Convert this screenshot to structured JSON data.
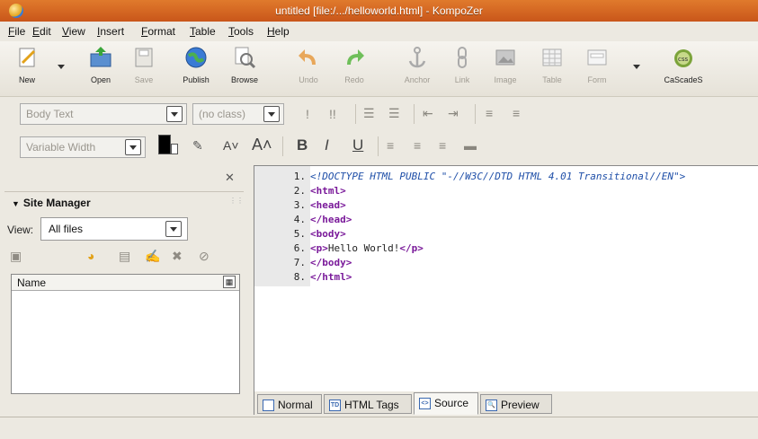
{
  "window": {
    "title": "untitled [file:/.../helloworld.html] - KompoZer"
  },
  "menu": [
    "File",
    "Edit",
    "View",
    "Insert",
    "Format",
    "Table",
    "Tools",
    "Help"
  ],
  "toolbar": {
    "new": "New",
    "open": "Open",
    "save": "Save",
    "publish": "Publish",
    "browse": "Browse",
    "undo": "Undo",
    "redo": "Redo",
    "anchor": "Anchor",
    "link": "Link",
    "image": "Image",
    "table": "Table",
    "form": "Form",
    "cascades": "CaScadeS"
  },
  "format": {
    "paragraph_style": "Body Text",
    "class": "(no class)",
    "font": "Variable Width",
    "text_color": "#000000"
  },
  "site_manager": {
    "title": "Site Manager",
    "view_label": "View:",
    "view_value": "All files",
    "column_name": "Name"
  },
  "editor": {
    "lines": [
      {
        "num": "1.",
        "parts": [
          [
            "doctype",
            "<!DOCTYPE HTML PUBLIC \"-//W3C//DTD HTML 4.01 Transitional//EN\">"
          ]
        ]
      },
      {
        "num": "2.",
        "parts": [
          [
            "tag",
            "<html>"
          ]
        ]
      },
      {
        "num": "3.",
        "parts": [
          [
            "tag",
            "<head>"
          ]
        ]
      },
      {
        "num": "4.",
        "parts": [
          [
            "tag",
            "</head>"
          ]
        ]
      },
      {
        "num": "5.",
        "parts": [
          [
            "tag",
            "<body>"
          ]
        ]
      },
      {
        "num": "6.",
        "parts": [
          [
            "tag",
            "<p>"
          ],
          [
            "code",
            "Hello World!"
          ],
          [
            "tag",
            "</p>"
          ]
        ]
      },
      {
        "num": "7.",
        "parts": [
          [
            "tag",
            "</body>"
          ]
        ]
      },
      {
        "num": "8.",
        "parts": [
          [
            "tag",
            "</html>"
          ]
        ]
      }
    ]
  },
  "tabs": {
    "normal": "Normal",
    "html_tags": "HTML Tags",
    "source": "Source",
    "preview": "Preview",
    "active": "Source"
  }
}
